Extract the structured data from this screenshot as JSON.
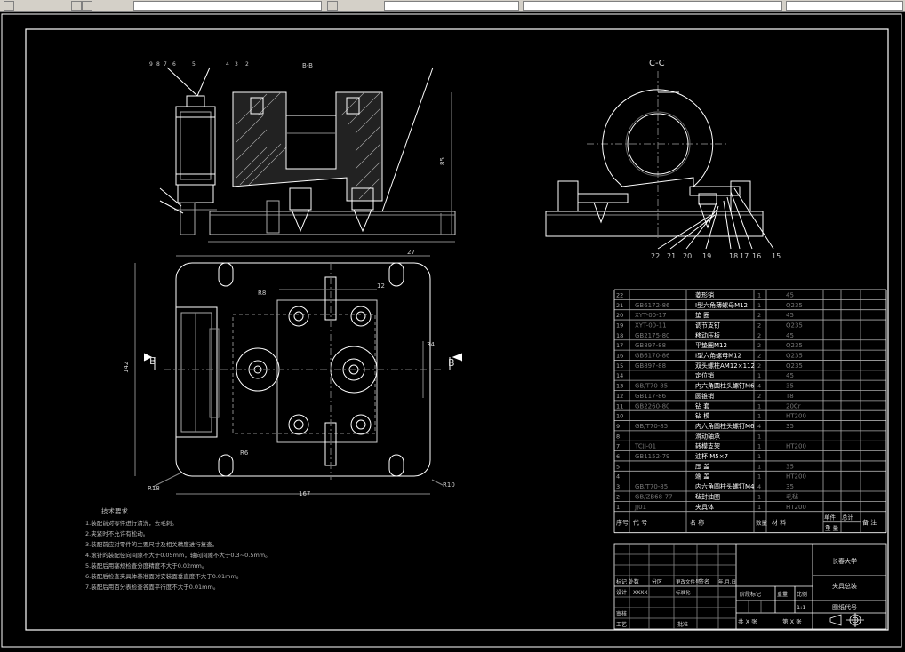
{
  "section_label": "C-C",
  "section_label_top": "B-B",
  "view_arrow_left": "B",
  "view_arrow_right": "B",
  "tech_title": "技术要求",
  "tech_notes": [
    "1.装配前对零件进行清洗，去毛刺。",
    "2.夹紧时不允许有松动。",
    "3.装配前应对零件的主要尺寸及相关精度进行复查。",
    "4.滚针的装配径向间隙不大于0.05mm，轴向间隙不大于0.3~0.5mm。",
    "5.装配后用塞规检查分度精度不大于0.02mm。",
    "6.装配后检查夹具体基准面对安装面垂直度不大于0.01mm。",
    "7.装配后用百分表检查各面平行度不大于0.01mm。"
  ],
  "balloons_right": [
    "22",
    "21",
    "20",
    "19",
    "18",
    "17",
    "16",
    "15"
  ],
  "balloons_top": [
    "9",
    "8",
    "7",
    "6",
    "5",
    "4",
    "3",
    "2"
  ],
  "dimensions": {
    "width_total": "167",
    "height_total": "142",
    "right_34": "34",
    "d12": "12",
    "r8_a": "R8",
    "r10": "R10",
    "r18": "R18",
    "r6": "R6",
    "d27": "27",
    "h85": "85"
  },
  "bom_rows": [
    {
      "no": "22",
      "code": "",
      "name": "菱形销",
      "qty": "1",
      "mat": "45"
    },
    {
      "no": "21",
      "code": "GB6172-86",
      "name": "I型六角薄螺母M12",
      "qty": "1",
      "mat": "Q235"
    },
    {
      "no": "20",
      "code": "XYT-00-17",
      "name": "垫  圈",
      "qty": "2",
      "mat": "45"
    },
    {
      "no": "19",
      "code": "XYT-00-11",
      "name": "调节支钉",
      "qty": "2",
      "mat": "Q235"
    },
    {
      "no": "18",
      "code": "GB2175-80",
      "name": "移动压板",
      "qty": "2",
      "mat": "45"
    },
    {
      "no": "17",
      "code": "GB897-88",
      "name": "平垫圈M12",
      "qty": "2",
      "mat": "Q235"
    },
    {
      "no": "16",
      "code": "GB6170-86",
      "name": "I型六角螺母M12",
      "qty": "2",
      "mat": "Q235"
    },
    {
      "no": "15",
      "code": "GB897-88",
      "name": "双头螺柱AM12×112",
      "qty": "2",
      "mat": "Q235"
    },
    {
      "no": "14",
      "code": "",
      "name": "定位销",
      "qty": "1",
      "mat": "45"
    },
    {
      "no": "13",
      "code": "GB/T70-85",
      "name": "内六角圆柱头螺钉M6",
      "qty": "4",
      "mat": "35"
    },
    {
      "no": "12",
      "code": "GB117-86",
      "name": "圆锥销",
      "qty": "2",
      "mat": "T8"
    },
    {
      "no": "11",
      "code": "GB2260-80",
      "name": "钻  套",
      "qty": "1",
      "mat": "20Cr"
    },
    {
      "no": "10",
      "code": "",
      "name": "钻  模",
      "qty": "1",
      "mat": "HT200"
    },
    {
      "no": "9",
      "code": "GB/T70-85",
      "name": "内六角圆柱头螺钉M6",
      "qty": "4",
      "mat": "35"
    },
    {
      "no": "8",
      "code": "",
      "name": "滑动轴承",
      "qty": "1",
      "mat": ""
    },
    {
      "no": "7",
      "code": "TCJJ-01",
      "name": "转模支架",
      "qty": "1",
      "mat": "HT200"
    },
    {
      "no": "6",
      "code": "GB1152-79",
      "name": "油杯 M5×7",
      "qty": "1",
      "mat": ""
    },
    {
      "no": "5",
      "code": "",
      "name": "压  盖",
      "qty": "1",
      "mat": "35"
    },
    {
      "no": "4",
      "code": "",
      "name": "端  盖",
      "qty": "1",
      "mat": "HT200"
    },
    {
      "no": "3",
      "code": "GB/T70-85",
      "name": "内六角圆柱头螺钉M4",
      "qty": "4",
      "mat": "35"
    },
    {
      "no": "2",
      "code": "GB/ZB68-77",
      "name": "毡封油圈",
      "qty": "1",
      "mat": "毛毡"
    },
    {
      "no": "1",
      "code": "JJ01",
      "name": "夹具体",
      "qty": "1",
      "mat": "HT200"
    }
  ],
  "bom_header": {
    "no": "序号",
    "code": "代        号",
    "name": "名      称",
    "qty": "数量",
    "mat": "材       料",
    "single": "单件",
    "total": "总计",
    "weight": "重    量",
    "remark": "备  注"
  },
  "title_block": {
    "school": "长春大学",
    "drawing_name": "夹具总装",
    "drawing_code": "图纸代号",
    "mark_count": "标记 处数",
    "sub_area": "分区",
    "change_doc": "更改文件号",
    "sign": "签名",
    "date": "年.月.日",
    "design": "设计",
    "design_name": "XXXX",
    "standardize": "标准化",
    "stage_mark": "阶段标记",
    "weight": "重量",
    "scale": "比例",
    "scale_value": "1:1",
    "review": "审核",
    "process": "工艺",
    "approve": "批准",
    "total_sheets": "共 X 张",
    "sheet_no": "第 X 张"
  }
}
